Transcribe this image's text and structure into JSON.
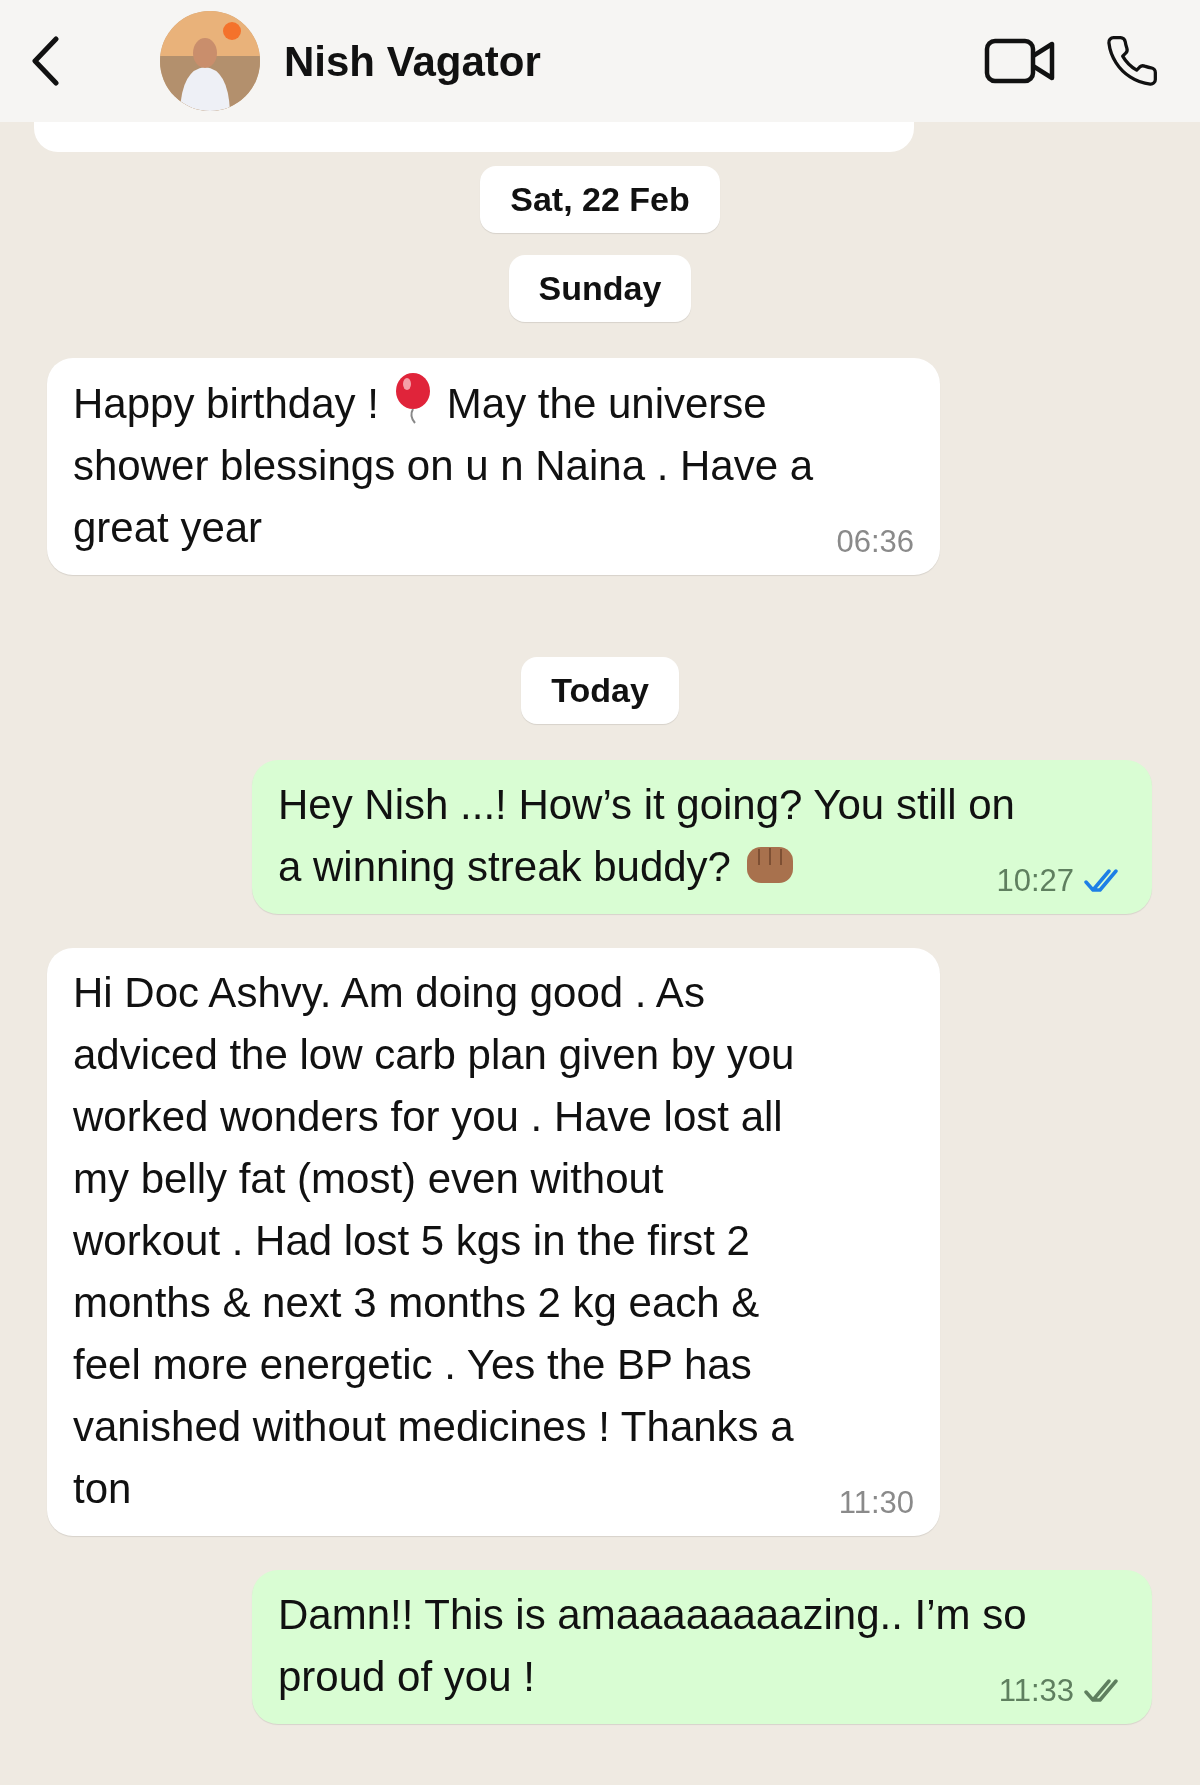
{
  "header": {
    "contact_name": "Nish Vagator"
  },
  "items": [
    {
      "kind": "fragment_in"
    },
    {
      "kind": "date",
      "text": "Sat, 22 Feb"
    },
    {
      "kind": "date",
      "text": "Sunday"
    },
    {
      "kind": "message_in",
      "lines": [
        [
          {
            "kind": "text",
            "text": "Happy birthday !"
          },
          {
            "kind": "balloon"
          },
          {
            "kind": "text",
            "text": "May the universe"
          }
        ],
        [
          {
            "kind": "text",
            "text": "shower blessings on u n Naina . Have a"
          }
        ],
        [
          {
            "kind": "text",
            "text": "great year"
          }
        ]
      ],
      "time": "06:36"
    },
    {
      "kind": "date",
      "text": "Today"
    },
    {
      "kind": "message_out",
      "lines": [
        [
          {
            "kind": "text",
            "text": "Hey Nish ...! How’s it going? You still on"
          }
        ],
        [
          {
            "kind": "text",
            "text": "a winning streak buddy?"
          },
          {
            "kind": "fist"
          }
        ]
      ],
      "time": "10:27",
      "read": true
    },
    {
      "kind": "message_in",
      "lines": [
        [
          {
            "kind": "text",
            "text": "Hi Doc Ashvy. Am doing good . As"
          }
        ],
        [
          {
            "kind": "text",
            "text": "adviced the low carb plan given by you"
          }
        ],
        [
          {
            "kind": "text",
            "text": "worked wonders for you . Have lost all"
          }
        ],
        [
          {
            "kind": "text",
            "text": "my belly fat (most) even without"
          }
        ],
        [
          {
            "kind": "text",
            "text": "workout . Had lost 5 kgs in the first 2"
          }
        ],
        [
          {
            "kind": "text",
            "text": "months & next 3 months 2 kg each &"
          }
        ],
        [
          {
            "kind": "text",
            "text": "feel more energetic . Yes the BP has"
          }
        ],
        [
          {
            "kind": "text",
            "text": "vanished without medicines ! Thanks a"
          }
        ],
        [
          {
            "kind": "text",
            "text": "ton"
          }
        ]
      ],
      "time": "11:30"
    },
    {
      "kind": "message_out",
      "lines": [
        [
          {
            "kind": "text",
            "text": "Damn!! This is amaaaaaaaazing.. I’m so"
          }
        ],
        [
          {
            "kind": "text",
            "text": "proud of you !"
          }
        ]
      ],
      "time": "11:33",
      "read": false
    }
  ]
}
